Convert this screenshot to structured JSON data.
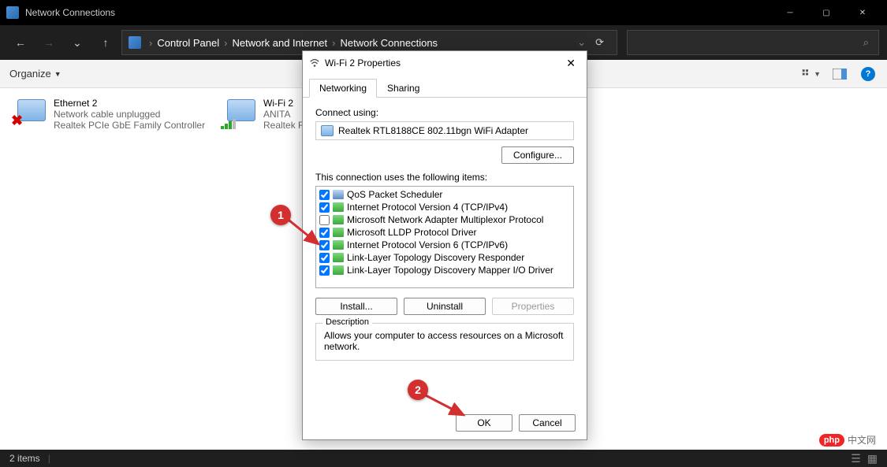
{
  "window": {
    "title": "Network Connections"
  },
  "breadcrumb": {
    "root": "Control Panel",
    "mid": "Network and Internet",
    "leaf": "Network Connections"
  },
  "toolbar": {
    "organize": "Organize"
  },
  "adapters": {
    "ethernet": {
      "name": "Ethernet 2",
      "status": "Network cable unplugged",
      "device": "Realtek PCIe GbE Family Controller"
    },
    "wifi": {
      "name": "Wi-Fi 2",
      "status": "ANITA",
      "device": "Realtek RT"
    }
  },
  "dialog": {
    "title": "Wi-Fi 2 Properties",
    "tabs": {
      "networking": "Networking",
      "sharing": "Sharing"
    },
    "connect_label": "Connect using:",
    "adapter_name": "Realtek RTL8188CE 802.11bgn WiFi Adapter",
    "configure_btn": "Configure...",
    "items_label": "This connection uses the following items:",
    "items": [
      {
        "checked": true,
        "icon": "blue",
        "label": "QoS Packet Scheduler"
      },
      {
        "checked": true,
        "icon": "green",
        "label": "Internet Protocol Version 4 (TCP/IPv4)"
      },
      {
        "checked": false,
        "icon": "green",
        "label": "Microsoft Network Adapter Multiplexor Protocol"
      },
      {
        "checked": true,
        "icon": "green",
        "label": "Microsoft LLDP Protocol Driver"
      },
      {
        "checked": true,
        "icon": "green",
        "label": "Internet Protocol Version 6 (TCP/IPv6)"
      },
      {
        "checked": true,
        "icon": "green",
        "label": "Link-Layer Topology Discovery Responder"
      },
      {
        "checked": true,
        "icon": "green",
        "label": "Link-Layer Topology Discovery Mapper I/O Driver"
      }
    ],
    "install_btn": "Install...",
    "uninstall_btn": "Uninstall",
    "properties_btn": "Properties",
    "desc_legend": "Description",
    "desc_text": "Allows your computer to access resources on a Microsoft network.",
    "ok_btn": "OK",
    "cancel_btn": "Cancel"
  },
  "statusbar": {
    "count": "2 items"
  },
  "annotations": {
    "marker1": "1",
    "marker2": "2"
  },
  "watermark": {
    "logo": "php",
    "text": "中文网"
  }
}
